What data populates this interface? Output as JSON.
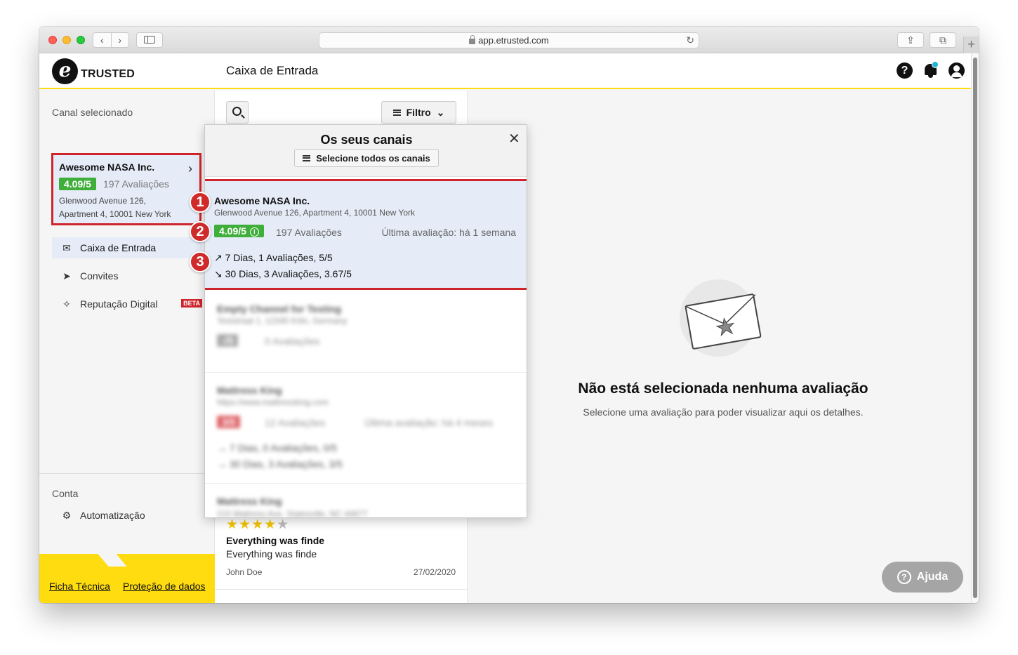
{
  "browser": {
    "url": "app.etrusted.com"
  },
  "app": {
    "logo_text": "TRUSTED",
    "logo_letter": "e",
    "page_title": "Caixa de Entrada",
    "help_icon_glyph": "?"
  },
  "sidebar": {
    "selected_channel_label": "Canal selecionado",
    "channel": {
      "name": "Awesome NASA Inc.",
      "score": "4.09/5",
      "reviews": "197 Avaliações",
      "address_line1": "Glenwood Avenue 126,",
      "address_line2": "Apartment 4, 10001 New York"
    },
    "nav": [
      {
        "label": "Caixa de Entrada",
        "icon": "inbox-icon",
        "active": true
      },
      {
        "label": "Convites",
        "icon": "send-icon",
        "active": false
      },
      {
        "label": "Reputação Digital",
        "icon": "sparkle-icon",
        "badge": "BETA",
        "active": false
      }
    ],
    "account_label": "Conta",
    "account_items": [
      {
        "label": "Automatização",
        "icon": "robot-icon"
      }
    ],
    "footer_links": [
      "Ficha Técnica",
      "Proteção de dados"
    ]
  },
  "list": {
    "filter_label": "Filtro",
    "review": {
      "rating": 4,
      "max_rating": 5,
      "title": "Everything was finde",
      "text": "Everything was finde",
      "author": "John Doe",
      "date": "27/02/2020"
    }
  },
  "popover": {
    "title": "Os seus canais",
    "select_all": "Selecione todos os canais",
    "selected_channel": {
      "name": "Awesome NASA Inc.",
      "address": "Glenwood Avenue 126, Apartment 4, 10001 New York",
      "score": "4.09/5",
      "reviews": "197 Avaliações",
      "last_review": "Última avaliação: há 1 semana",
      "trend_7": "7 Dias, 1 Avaliações, 5/5",
      "trend_30": "30 Dias, 3 Avaliações, 3.67/5"
    },
    "blurred_channels": [
      {
        "name": "Empty Channel for Testing",
        "address": "Teststraat 1, 12345 Köln, Germany",
        "score": "-/5",
        "reviews": "0 Avaliações"
      },
      {
        "name": "Mattress King",
        "address": "https://www.mattressking.com",
        "score": "3/5",
        "reviews": "12 Avaliações",
        "last_review": "Última avaliação: há 4 meses",
        "trend_7": "7 Dias, 0 Avaliações, 0/5",
        "trend_30": "30 Dias, 3 Avaliações, 3/5"
      },
      {
        "name": "Mattress King",
        "address": "215 Mattress Ave, Statesville, NC 44877"
      }
    ]
  },
  "callouts": [
    "1",
    "2",
    "3"
  ],
  "empty_state": {
    "title": "Não está selecionada nenhuma avaliação",
    "subtitle": "Selecione uma avaliação para poder visualizar aqui os detalhes."
  },
  "help_button": "Ajuda",
  "colors": {
    "accent_yellow": "#ffdc0f",
    "score_green": "#3fae3a",
    "highlight_red": "#d0242b",
    "selection_blue": "#e5ecf7"
  }
}
